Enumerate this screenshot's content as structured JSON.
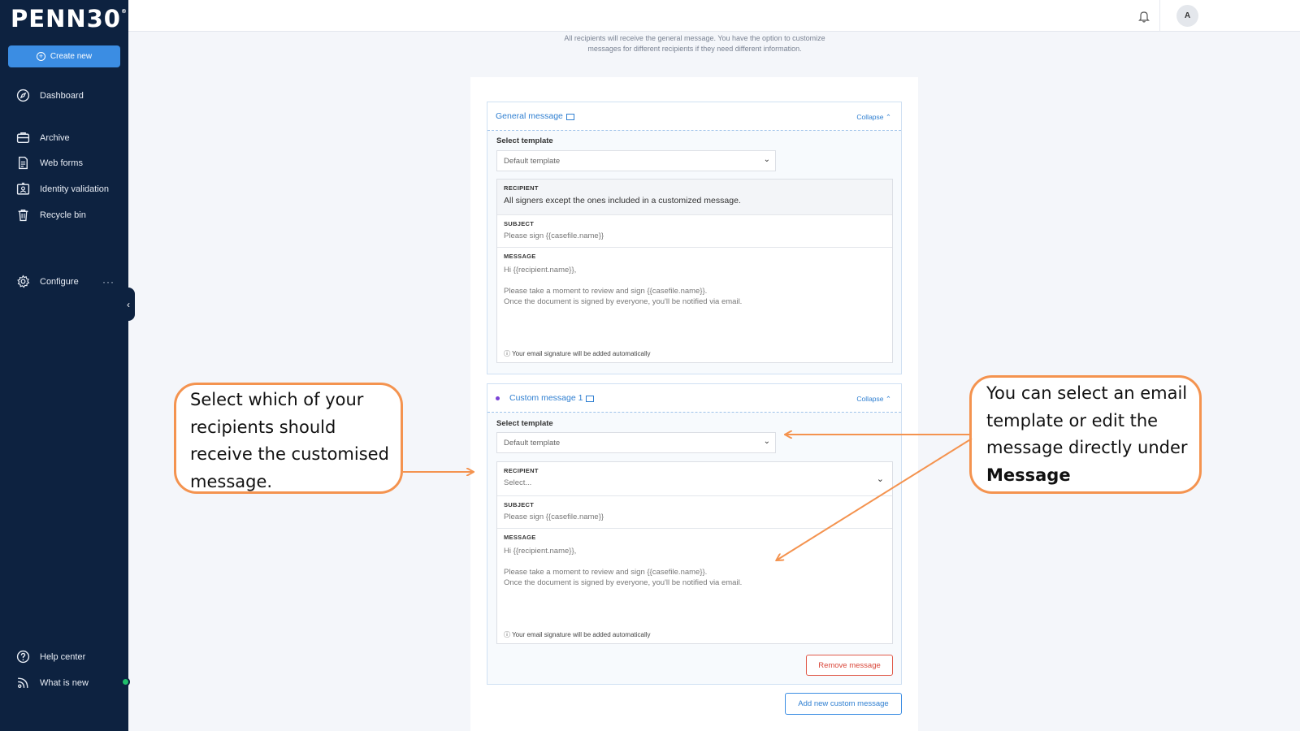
{
  "brand": {
    "logo_text": "PENN30",
    "trademark": "®"
  },
  "sidebar": {
    "create_label": "Create new",
    "items": [
      {
        "label": "Dashboard",
        "icon": "compass-icon"
      },
      {
        "label": "Archive",
        "icon": "briefcase-icon"
      },
      {
        "label": "Web forms",
        "icon": "document-icon"
      },
      {
        "label": "Identity validation",
        "icon": "id-card-icon"
      },
      {
        "label": "Recycle bin",
        "icon": "trash-icon"
      },
      {
        "label": "Configure",
        "icon": "gear-icon"
      },
      {
        "label": "Help center",
        "icon": "question-icon"
      },
      {
        "label": "What is new",
        "icon": "broadcast-icon"
      }
    ],
    "more_glyph": "···",
    "collapse_glyph": "‹"
  },
  "topbar": {
    "avatar_initial": "A"
  },
  "intro_text": "All recipients will receive the general message. You have the option to customize messages for different recipients if they need different information.",
  "general": {
    "title": "General message",
    "collapse_label": "Collapse",
    "template_label": "Select template",
    "template_value": "Default template",
    "recipient_label": "RECIPIENT",
    "recipient_value": "All signers except the ones included in a customized message.",
    "subject_label": "SUBJECT",
    "subject_value": "Please sign {{casefile.name}}",
    "message_label": "MESSAGE",
    "message_line1": "Hi {{recipient.name}},",
    "message_line2": "Please take a moment to review and sign {{casefile.name}}.",
    "message_line3": "Once the document is signed by everyone, you'll be notified via email.",
    "signature_note": "Your email signature will be added automatically"
  },
  "custom": {
    "title": "Custom message 1",
    "collapse_label": "Collapse",
    "template_label": "Select template",
    "template_value": "Default template",
    "recipient_label": "RECIPIENT",
    "recipient_placeholder": "Select...",
    "subject_label": "SUBJECT",
    "subject_value": "Please sign {{casefile.name}}",
    "message_label": "MESSAGE",
    "message_line1": "Hi {{recipient.name}},",
    "message_line2": "Please take a moment to review and sign {{casefile.name}}.",
    "message_line3": "Once the document is signed by everyone, you'll be notified via email.",
    "signature_note": "Your email signature will be added automatically",
    "remove_label": "Remove message"
  },
  "add_custom_label": "Add new custom message",
  "callouts": {
    "left": "Select which of your recipients should receive the customised message.",
    "right_prefix": "You can select an email template or edit the message directly under ",
    "right_bold": "Message"
  },
  "colors": {
    "sidebar_bg": "#0d2240",
    "accent": "#3b8de3",
    "callout_border": "#f4934f",
    "remove": "#d9473a",
    "status_online": "#1fbf6a"
  }
}
